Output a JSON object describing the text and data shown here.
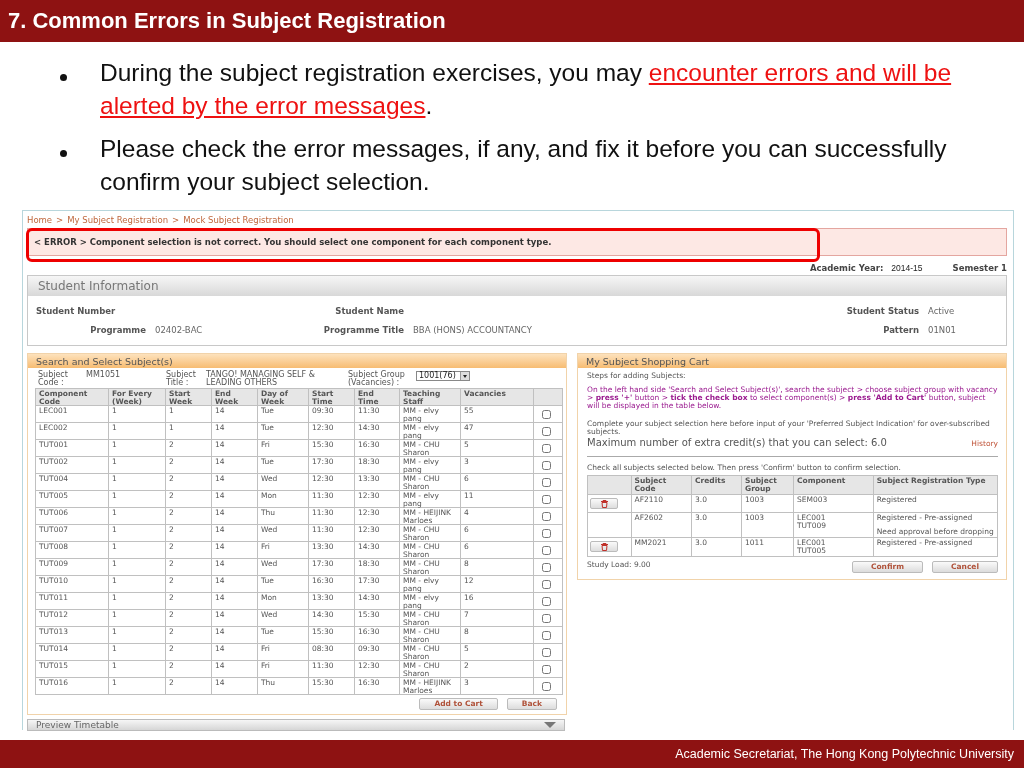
{
  "slide": {
    "title": "7. Common Errors in Subject Registration",
    "bullets": [
      {
        "parts": [
          {
            "kind": "plain",
            "text": "During the subject registration exercises, you may "
          },
          {
            "kind": "highlight",
            "text": "encounter errors and will be alerted by the error messages"
          },
          {
            "kind": "plain",
            "text": "."
          }
        ]
      },
      {
        "parts": [
          {
            "kind": "plain",
            "text": "Please check the error messages, if any, and fix it before you can successfully confirm your subject selection."
          }
        ]
      }
    ],
    "footer": "Academic Secretariat, The Hong Kong Polytechnic University"
  },
  "page": {
    "breadcrumb": [
      "Home",
      ">",
      "My Subject Registration",
      ">",
      "Mock Subject Registration"
    ],
    "error": "< ERROR > Component selection is not correct. You should select one component for each component type.",
    "academic_year": {
      "label": "Academic Year:",
      "value": "2014-15"
    },
    "semester": "Semester 1",
    "student_info": {
      "title": "Student Information",
      "fields": [
        {
          "label": "Student Number"
        },
        {
          "label": "Student Name"
        },
        {
          "label": "Student Status",
          "value": "Active"
        },
        {
          "label": "Programme",
          "value": "02402-BAC"
        },
        {
          "label": "Programme Title",
          "value": "BBA (HONS) ACCOUNTANCY"
        },
        {
          "label": "Pattern",
          "value": "01N01"
        }
      ]
    },
    "search": {
      "title": "Search and Select Subject(s)",
      "subject_code": {
        "label": "Subject Code :",
        "value": "MM1051"
      },
      "subject_title": {
        "label": "Subject Title :",
        "value": "TANGO! MANAGING SELF & LEADING OTHERS"
      },
      "subject_group": {
        "label": "Subject Group (Vacancies) :",
        "value": "1001(76)"
      },
      "columns": [
        "Component Code",
        "For Every (Week)",
        "Start Week",
        "End Week",
        "Day of Week",
        "Start Time",
        "End Time",
        "Teaching Staff",
        "Vacancies"
      ],
      "rows": [
        {
          "cells": [
            "LEC001",
            "1",
            "1",
            "14",
            "Tue",
            "09:30",
            "11:30",
            "MM - elvy pang",
            "55"
          ],
          "checked": false
        },
        {
          "cells": [
            "LEC002",
            "1",
            "1",
            "14",
            "Tue",
            "12:30",
            "14:30",
            "MM - elvy pang",
            "47"
          ],
          "checked": false
        },
        {
          "cells": [
            "TUT001",
            "1",
            "2",
            "14",
            "Fri",
            "15:30",
            "16:30",
            "MM - CHU Sharon",
            "5"
          ],
          "checked": false
        },
        {
          "cells": [
            "TUT002",
            "1",
            "2",
            "14",
            "Tue",
            "17:30",
            "18:30",
            "MM - elvy pang",
            "3"
          ],
          "checked": false
        },
        {
          "cells": [
            "TUT004",
            "1",
            "2",
            "14",
            "Wed",
            "12:30",
            "13:30",
            "MM - CHU Sharon",
            "6"
          ],
          "checked": false
        },
        {
          "cells": [
            "TUT005",
            "1",
            "2",
            "14",
            "Mon",
            "11:30",
            "12:30",
            "MM - elvy pang",
            "11"
          ],
          "checked": false
        },
        {
          "cells": [
            "TUT006",
            "1",
            "2",
            "14",
            "Thu",
            "11:30",
            "12:30",
            "MM - HEIJINK Marloes",
            "4"
          ],
          "checked": false
        },
        {
          "cells": [
            "TUT007",
            "1",
            "2",
            "14",
            "Wed",
            "11:30",
            "12:30",
            "MM - CHU Sharon",
            "6"
          ],
          "checked": false
        },
        {
          "cells": [
            "TUT008",
            "1",
            "2",
            "14",
            "Fri",
            "13:30",
            "14:30",
            "MM - CHU Sharon",
            "6"
          ],
          "checked": false
        },
        {
          "cells": [
            "TUT009",
            "1",
            "2",
            "14",
            "Wed",
            "17:30",
            "18:30",
            "MM - CHU Sharon",
            "8"
          ],
          "checked": false
        },
        {
          "cells": [
            "TUT010",
            "1",
            "2",
            "14",
            "Tue",
            "16:30",
            "17:30",
            "MM - elvy pang",
            "12"
          ],
          "checked": false
        },
        {
          "cells": [
            "TUT011",
            "1",
            "2",
            "14",
            "Mon",
            "13:30",
            "14:30",
            "MM - elvy pang",
            "16"
          ],
          "checked": false
        },
        {
          "cells": [
            "TUT012",
            "1",
            "2",
            "14",
            "Wed",
            "14:30",
            "15:30",
            "MM - CHU Sharon",
            "7"
          ],
          "checked": false
        },
        {
          "cells": [
            "TUT013",
            "1",
            "2",
            "14",
            "Tue",
            "15:30",
            "16:30",
            "MM - CHU Sharon",
            "8"
          ],
          "checked": false
        },
        {
          "cells": [
            "TUT014",
            "1",
            "2",
            "14",
            "Fri",
            "08:30",
            "09:30",
            "MM - CHU Sharon",
            "5"
          ],
          "checked": false
        },
        {
          "cells": [
            "TUT015",
            "1",
            "2",
            "14",
            "Fri",
            "11:30",
            "12:30",
            "MM - CHU Sharon",
            "2"
          ],
          "checked": false
        },
        {
          "cells": [
            "TUT016",
            "1",
            "2",
            "14",
            "Thu",
            "15:30",
            "16:30",
            "MM - HEIJINK Marloes",
            "3"
          ],
          "checked": false
        }
      ],
      "buttons": [
        "Add to Cart",
        "Back"
      ]
    },
    "cart": {
      "title": "My Subject Shopping Cart",
      "steps_heading": "Steps for adding Subjects:",
      "steps": "On the left hand side 'Search and Select Subject(s)', search the subject > choose subject group with vacancy > **press '+'** button > **tick the check box** to select component(s) > **press 'Add to Cart'** button, subject will be displayed in the table below.",
      "note": "Complete your subject selection here before input of your 'Preferred Subject Indication' for over-subscribed subjects.",
      "max_credit": "Maximum number of extra credit(s) that you can select: 6.0",
      "history": "History",
      "check_note": "Check all subjects selected below. Then press 'Confirm' button to confirm selection.",
      "columns": [
        "Subject Code",
        "Credits",
        "Subject Group",
        "Component",
        "Subject Registration Type"
      ],
      "rows": [
        {
          "deletable": true,
          "code": "AF2110",
          "credits": "3.0",
          "group": "1003",
          "components": [
            "SEM003"
          ],
          "types": [
            "Registered"
          ]
        },
        {
          "deletable": false,
          "code": "AF2602",
          "credits": "3.0",
          "group": "1003",
          "components": [
            "LEC001",
            "TUT009"
          ],
          "types": [
            "Registered - Pre-assigned",
            "Need approval before dropping"
          ]
        },
        {
          "deletable": true,
          "code": "MM2021",
          "credits": "3.0",
          "group": "1011",
          "components": [
            "LEC001",
            "TUT005"
          ],
          "types": [
            "Registered - Pre-assigned"
          ]
        }
      ],
      "study_load": "Study Load: 9.00",
      "buttons": [
        "Confirm",
        "Cancel"
      ]
    },
    "preview": {
      "title": "Preview Timetable",
      "expanded": false
    }
  }
}
